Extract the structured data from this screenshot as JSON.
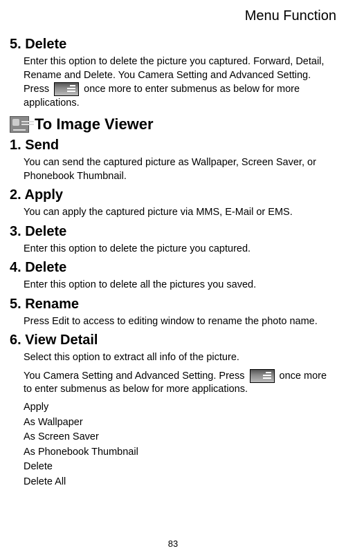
{
  "header": "Menu Function",
  "sections": {
    "s5": {
      "title": "5. Delete",
      "body": "Enter this option to delete the picture you captured. Forward, Detail, Rename and Delete. You Camera Setting and Advanced Setting. Press",
      "body2": "once more to enter submenus as below for more applications."
    },
    "viewer": {
      "title": "To Image Viewer"
    },
    "s1": {
      "title": "1. Send",
      "body": "You can send the captured picture as Wallpaper, Screen Saver, or Phonebook Thumbnail."
    },
    "s2": {
      "title": "2. Apply",
      "body": "You can apply the captured picture via MMS, E-Mail or EMS."
    },
    "s3": {
      "title": "3. Delete",
      "body": "Enter this option to delete the picture you captured."
    },
    "s4": {
      "title": "4. Delete",
      "body": "Enter this option to delete all the pictures you saved."
    },
    "s5b": {
      "title": "5. Rename",
      "body": "Press Edit to access to editing window to rename the photo name."
    },
    "s6": {
      "title": "6. View Detail",
      "body1": "Select this option to extract all info of the picture.",
      "body2a": "You Camera Setting and Advanced Setting. Press",
      "body2b": "once more to enter submenus as below for more applications.",
      "list": {
        "i0": "Apply",
        "i1": "As Wallpaper",
        "i2": "As Screen Saver",
        "i3": "As Phonebook Thumbnail",
        "i4": "Delete",
        "i5": "Delete All"
      }
    }
  },
  "page_number": "83"
}
